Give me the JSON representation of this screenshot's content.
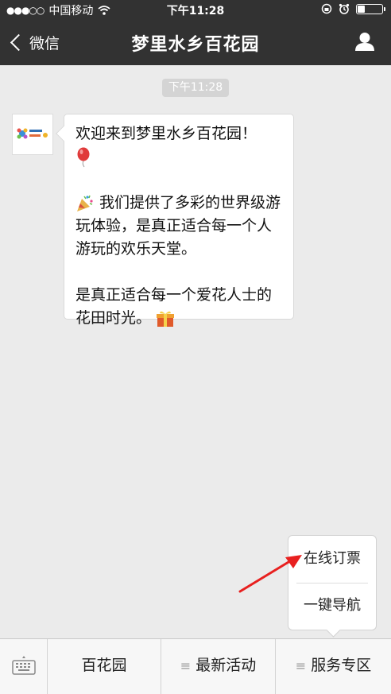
{
  "status_bar": {
    "carrier": "中国移动",
    "time": "下午11:28"
  },
  "nav": {
    "back_label": "微信",
    "title": "梦里水乡百花园",
    "icons": {
      "back": "chevron-left-icon",
      "profile": "user-icon"
    }
  },
  "chat": {
    "time_tag": "下午11:28",
    "avatar_icon": "account-logo-icon",
    "message": {
      "line1": "欢迎来到梦里水乡百花园！",
      "para2": "我们提供了多彩的世界级游玩体验，是真正适合每一个人游玩的欢乐天堂。",
      "para3": "是真正适合每一个爱花人士的花田时光。",
      "emojis": [
        "balloon-emoji",
        "party-popper-emoji",
        "gift-emoji"
      ]
    }
  },
  "popup_menu": {
    "items": [
      "在线订票",
      "一键导航"
    ]
  },
  "bottom_menu": {
    "keyboard_icon": "keyboard-icon",
    "items": [
      {
        "label": "百花园",
        "has_submenu": false
      },
      {
        "label": "最新活动",
        "has_submenu": true
      },
      {
        "label": "服务专区",
        "has_submenu": true
      }
    ],
    "submenu_glyph": "≡"
  },
  "colors": {
    "nav_bg": "#323232",
    "chat_bg": "#ebebeb",
    "annotation_arrow": "#e8201f"
  }
}
